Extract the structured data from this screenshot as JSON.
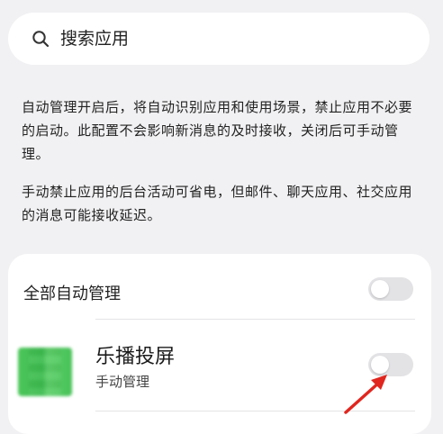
{
  "search": {
    "placeholder": "搜索应用",
    "icon": "search-icon"
  },
  "description": {
    "paragraph1": "自动管理开启后，将自动识别应用和使用场景，禁止应用不必要的启动。此配置不会影响新消息的及时接收，关闭后可手动管理。",
    "paragraph2": "手动禁止应用的后台活动可省电，但邮件、聊天应用、社交应用的消息可能接收延迟。"
  },
  "settings_card": {
    "all_auto_manage": {
      "label": "全部自动管理",
      "enabled": false
    },
    "apps": [
      {
        "name": "乐播投屏",
        "status": "手动管理",
        "enabled": false,
        "icon": "app-icon-blurred"
      }
    ]
  },
  "colors": {
    "background": "#f1f1f3",
    "card": "#ffffff",
    "toggle_off": "#e3e3e6",
    "annotation_arrow": "#e0261f"
  }
}
